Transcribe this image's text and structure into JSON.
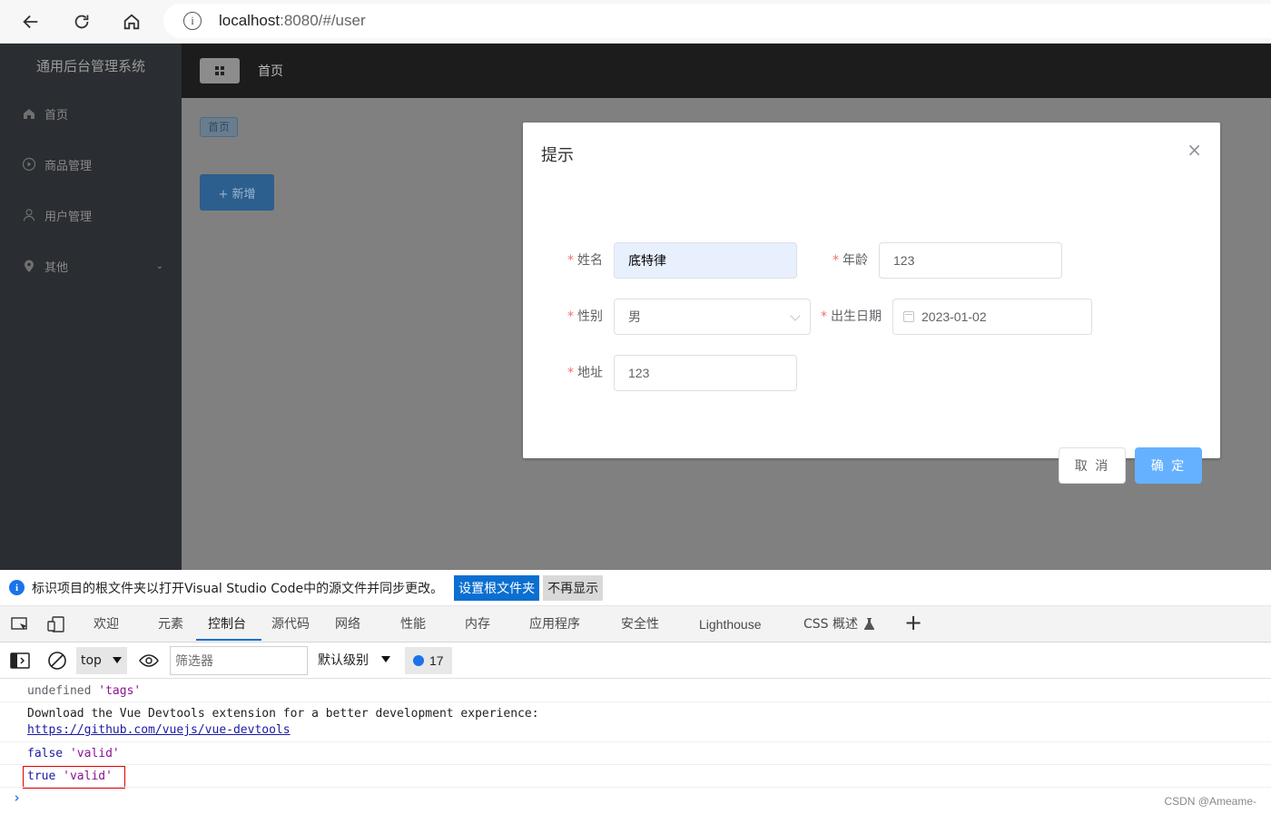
{
  "browser": {
    "url_host": "localhost",
    "url_rest": ":8080/#/user"
  },
  "app": {
    "title": "通用后台管理系统",
    "sidebar": [
      {
        "label": "首页",
        "icon": "home-icon"
      },
      {
        "label": "商品管理",
        "icon": "video-play-icon"
      },
      {
        "label": "用户管理",
        "icon": "user-icon"
      },
      {
        "label": "其他",
        "icon": "location-icon"
      }
    ],
    "topbar_home": "首页",
    "tag_home": "首页",
    "add_button": "+ 新增"
  },
  "dialog": {
    "title": "提示",
    "close": "×",
    "fields": {
      "name": {
        "label": "姓名",
        "value": "底特律"
      },
      "age": {
        "label": "年龄",
        "value": "123"
      },
      "gender": {
        "label": "性别",
        "value": "男"
      },
      "birth": {
        "label": "出生日期",
        "value": "2023-01-02"
      },
      "address": {
        "label": "地址",
        "value": "123"
      }
    },
    "required_mark": "*",
    "cancel": "取 消",
    "confirm": "确 定"
  },
  "devtools": {
    "notice": "标识项目的根文件夹以打开Visual Studio Code中的源文件并同步更改。",
    "set_root": "设置根文件夹",
    "dismiss": "不再显示",
    "tabs": [
      "欢迎",
      "元素",
      "控制台",
      "源代码",
      "网络",
      "性能",
      "内存",
      "应用程序",
      "安全性",
      "Lighthouse",
      "CSS 概述"
    ],
    "active_tab": "控制台",
    "context": "top",
    "filter_placeholder": "筛选器",
    "level": "默认级别",
    "message_count": "17",
    "console": {
      "line1_a": "undefined",
      "line1_b": "'tags'",
      "line2": "Download the Vue Devtools extension for a better development experience:",
      "line2_link": "https://github.com/vuejs/vue-devtools",
      "line3_a": "false",
      "line3_b": "'valid'",
      "line4_a": "true",
      "line4_b": "'valid'",
      "prompt": "›"
    }
  },
  "watermark": "CSDN @Ameame-"
}
